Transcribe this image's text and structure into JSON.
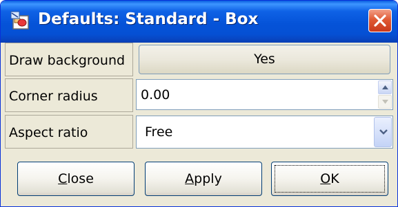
{
  "window": {
    "title": "Defaults: Standard - Box",
    "app_icon": "dialog-app-icon",
    "close_icon": "close-x-icon"
  },
  "properties": [
    {
      "label": "Draw background",
      "control": "toggle",
      "value": "Yes"
    },
    {
      "label": "Corner radius",
      "control": "spinner",
      "value": "0.00"
    },
    {
      "label": "Aspect ratio",
      "control": "combo",
      "value": "Free"
    }
  ],
  "buttons": {
    "close": {
      "pre": "",
      "mnemonic": "C",
      "post": "lose"
    },
    "apply": {
      "pre": "",
      "mnemonic": "A",
      "post": "pply"
    },
    "ok": {
      "pre": "",
      "mnemonic": "O",
      "post": "K"
    }
  },
  "colors": {
    "titlebar": "#0553d8",
    "close_button": "#e05a34",
    "dialog_background": "#ece9d8"
  }
}
